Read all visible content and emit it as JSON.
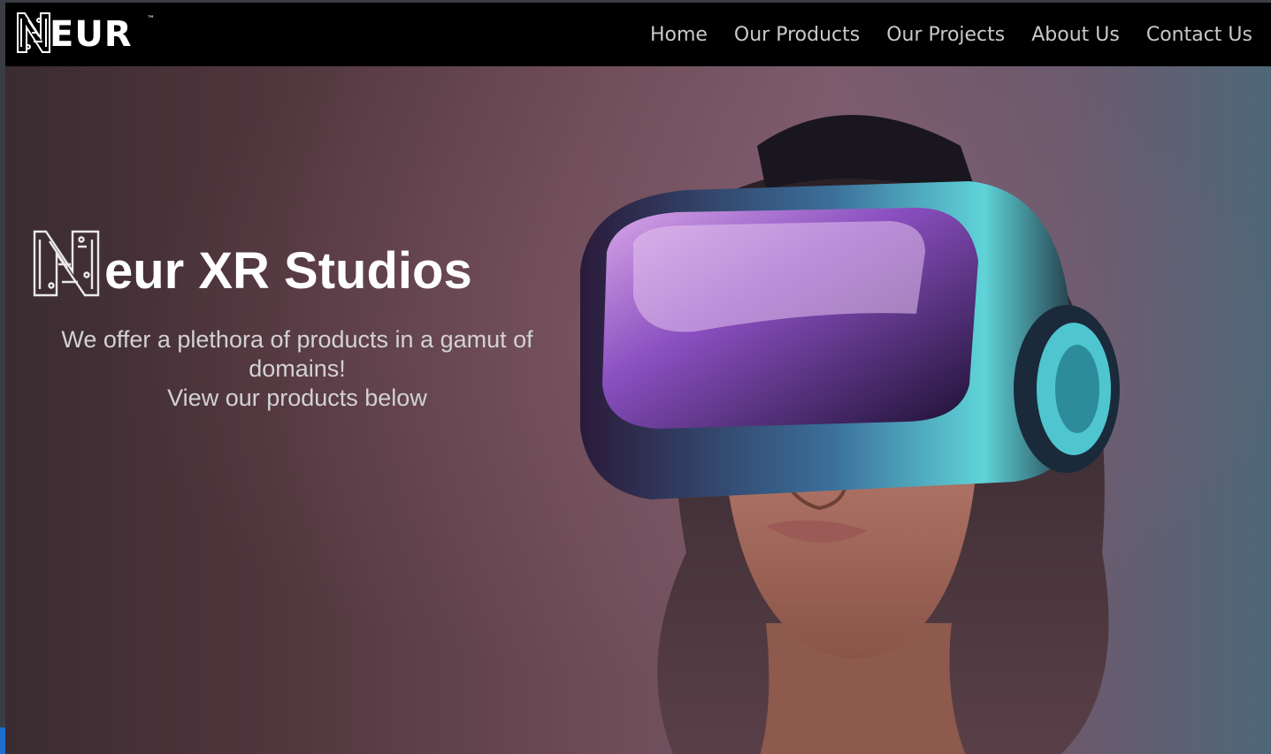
{
  "brand": {
    "name": "EUR",
    "trademark": "™"
  },
  "nav": {
    "links": [
      "Home",
      "Our Products",
      "Our Projects",
      "About Us",
      "Contact Us"
    ]
  },
  "hero": {
    "title": "eur XR Studios",
    "subtitle_line1": "We offer a plethora of products in a gamut of",
    "subtitle_line2": "domains!",
    "subtitle_line3": "View our products below",
    "image_subject": "person-wearing-vr-headset"
  },
  "colors": {
    "navbar_bg": "#000000",
    "nav_text": "#c9c9c9",
    "title_text": "#ffffff",
    "subtitle_text": "#d2d2d2"
  }
}
